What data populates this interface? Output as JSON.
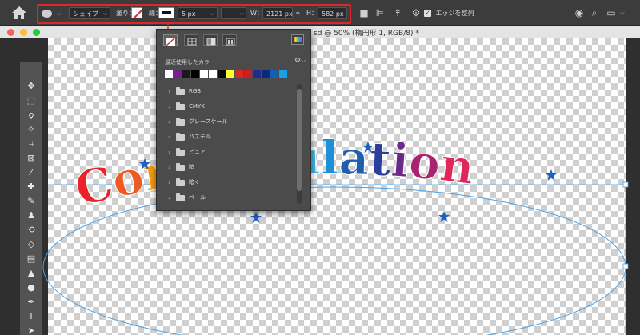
{
  "options_bar": {
    "home_icon": "home-icon",
    "shape_mode": "シェイプ",
    "fill_label": "塗り：",
    "stroke_label": "線：",
    "stroke_width": "5 px",
    "width_label": "W：",
    "width_value": "2121 px",
    "height_label": "H：",
    "height_value": "582 px",
    "align_edges_label": "エッジを整列",
    "align_edges_checked": true
  },
  "document": {
    "title": "sd @ 50% (楕円形 1, RGB/8) *"
  },
  "swatches_panel": {
    "recent_label": "最近使用したカラー",
    "recent_colors": [
      "#ffffff",
      "#7a1f8c",
      "#1a1a1a",
      "#000000",
      "#ffffff",
      "#ffffff",
      "#0a0a0a",
      "#ffff33",
      "#d9281f",
      "#cc2020",
      "#1f2e8a",
      "#0a2a7a",
      "#1060b8",
      "#1aa0e8"
    ],
    "folders": [
      "RGB",
      "CMYK",
      "グレースケール",
      "パステル",
      "ピュア",
      "暗",
      "暗く",
      "ペール"
    ]
  },
  "artwork": {
    "text": "Congratulation",
    "colors": [
      "#e8232a",
      "#ee5a24",
      "#f39c12",
      "#8cc63f",
      "#27ae60",
      "#16a085",
      "#1abc9c",
      "#3fb6e8",
      "#1e90d6",
      "#1f5fae",
      "#2a3f9a",
      "#6a2a8a",
      "#a8246e",
      "#e0265a"
    ],
    "star_color": "#1f5fbf"
  }
}
